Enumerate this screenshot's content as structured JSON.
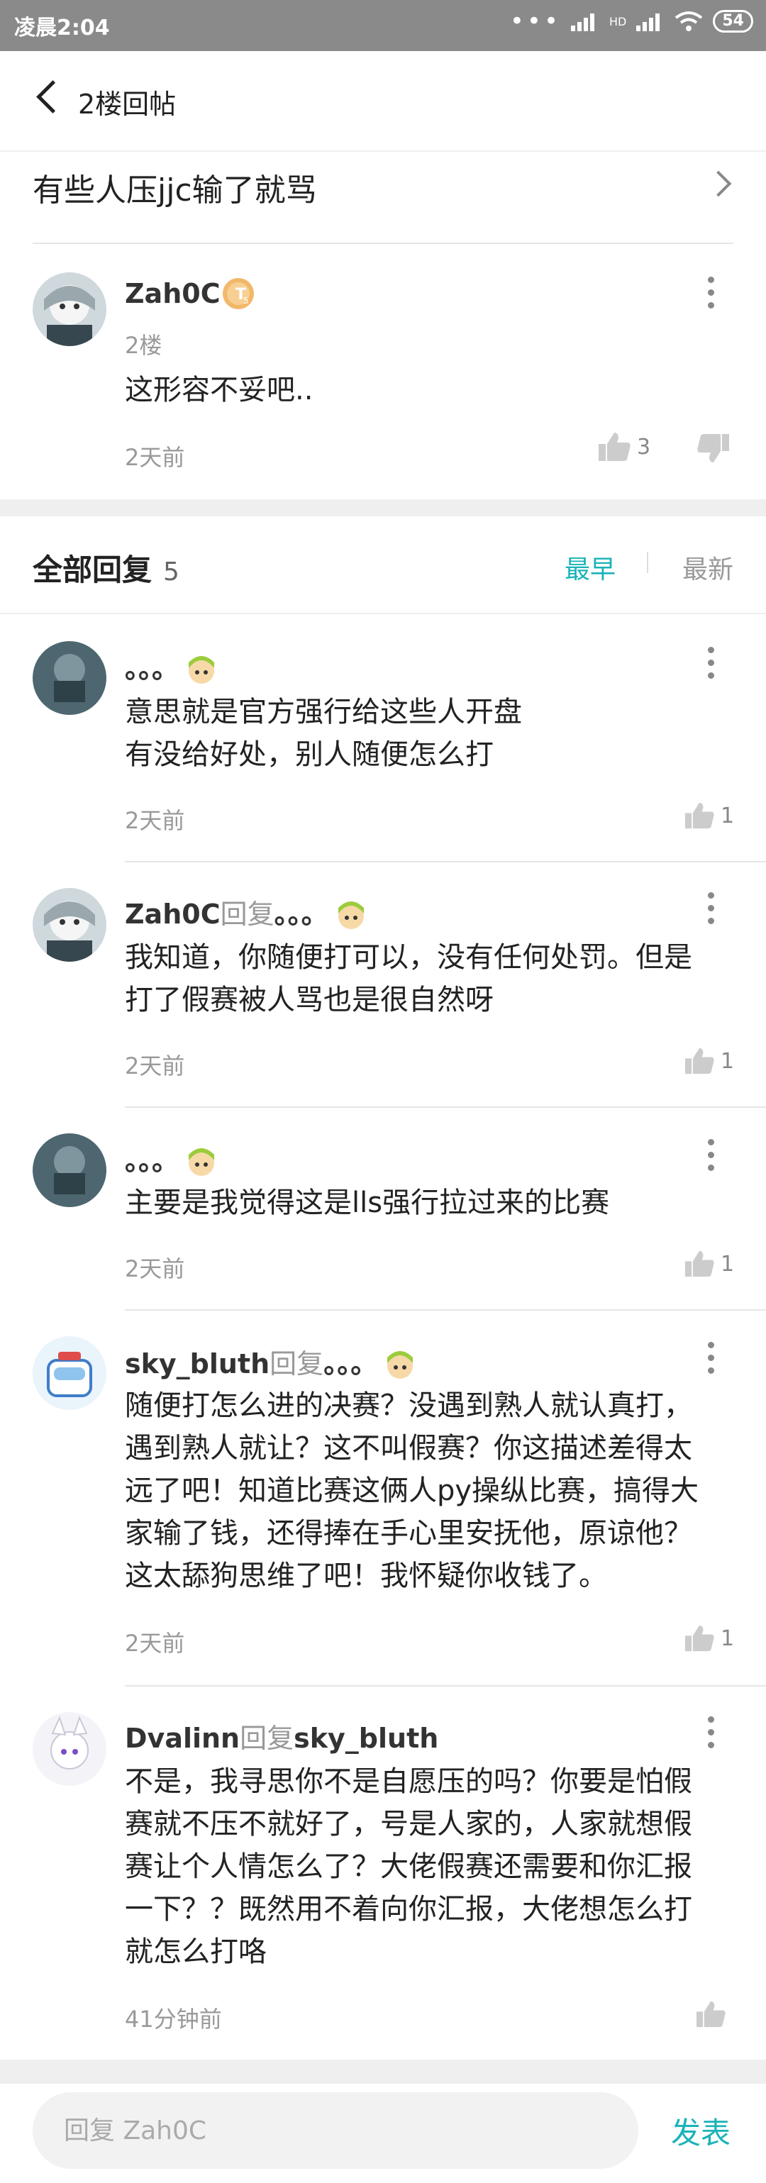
{
  "status_bar": {
    "time": "凌晨2:04",
    "network": "HD",
    "battery": "54"
  },
  "nav": {
    "title": "2楼回帖"
  },
  "post": {
    "title": "有些人压jjc输了就骂"
  },
  "floor": {
    "username": "Zah0C",
    "level_badge": "T5",
    "floor_label": "2楼",
    "content": "这形容不妥吧..",
    "time": "2天前",
    "like_count": "3"
  },
  "replies_header": {
    "title": "全部回复",
    "count": "5",
    "sort_earliest": "最早",
    "sort_latest": "最新"
  },
  "replies": [
    {
      "username": "。。。",
      "reply_word": "",
      "reply_to": "",
      "lines": [
        "意思就是官方强行给这些人开盘",
        "有没给好处，别人随便怎么打"
      ],
      "time": "2天前",
      "likes": "1"
    },
    {
      "username": "Zah0C",
      "reply_word": "回复",
      "reply_to": "。。。",
      "lines": [
        "我知道，你随便打可以，没有任何处罚。但是",
        "打了假赛被人骂也是很自然呀"
      ],
      "time": "2天前",
      "likes": "1"
    },
    {
      "username": "。。。",
      "reply_word": "",
      "reply_to": "",
      "lines": [
        "主要是我觉得这是lls强行拉过来的比赛"
      ],
      "time": "2天前",
      "likes": "1"
    },
    {
      "username": "sky_bluth",
      "reply_word": "回复",
      "reply_to": "。。。",
      "lines": [
        "随便打怎么进的决赛？没遇到熟人就认真打，",
        "遇到熟人就让？这不叫假赛？你这描述差得太",
        "远了吧！知道比赛这俩人py操纵比赛，搞得大",
        "家输了钱，还得捧在手心里安抚他，原谅他？",
        "这太舔狗思维了吧！我怀疑你收钱了。"
      ],
      "time": "2天前",
      "likes": "1"
    },
    {
      "username": "Dvalinn",
      "reply_word": "回复",
      "reply_to": "sky_bluth",
      "lines": [
        "不是，我寻思你不是自愿压的吗？你要是怕假",
        "赛就不压不就好了，号是人家的，人家就想假",
        "赛让个人情怎么了？大佬假赛还需要和你汇报",
        "一下？？既然用不着向你汇报，大佬想怎么打",
        "就怎么打咯"
      ],
      "time": "41分钟前",
      "likes": ""
    }
  ],
  "bottom_bar": {
    "placeholder": "回复 Zah0C",
    "send_label": "发表"
  },
  "colors": {
    "accent": "#1ab3b8",
    "status_bar": "#8a8a8a"
  },
  "icons": [
    "back-icon",
    "chevron-right-icon",
    "more-icon",
    "thumb-up-icon",
    "thumb-down-icon",
    "level-badge-icon",
    "emoji-icon"
  ]
}
